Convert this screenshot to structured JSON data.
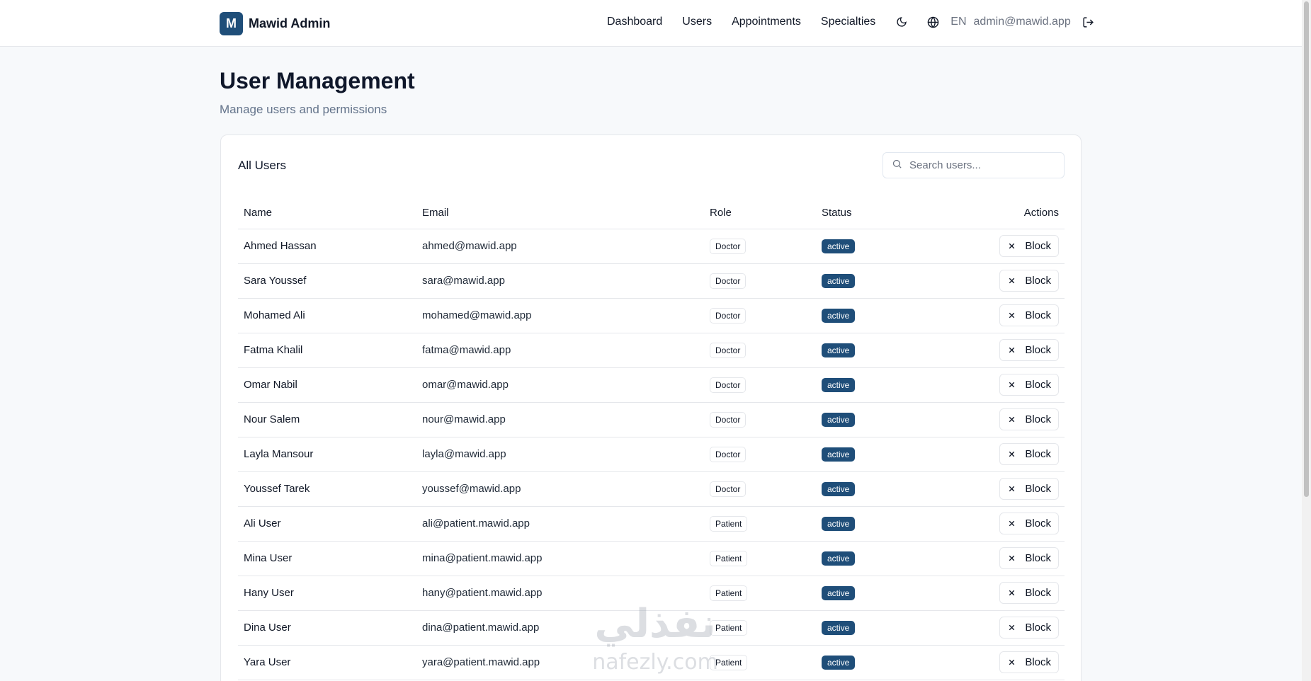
{
  "brand": {
    "logo_letter": "M",
    "name": "Mawid Admin"
  },
  "nav": {
    "links": [
      "Dashboard",
      "Users",
      "Appointments",
      "Specialties"
    ],
    "language": "EN",
    "user_email": "admin@mawid.app",
    "icons": [
      "moon-icon",
      "globe-icon",
      "logout-icon"
    ]
  },
  "page": {
    "title": "User Management",
    "subtitle": "Manage users and permissions"
  },
  "card": {
    "title": "All Users",
    "search_placeholder": "Search users...",
    "columns": [
      "Name",
      "Email",
      "Role",
      "Status",
      "Actions"
    ],
    "action_label": "Block",
    "rows": [
      {
        "name": "Ahmed Hassan",
        "email": "ahmed@mawid.app",
        "role": "Doctor",
        "status": "active"
      },
      {
        "name": "Sara Youssef",
        "email": "sara@mawid.app",
        "role": "Doctor",
        "status": "active"
      },
      {
        "name": "Mohamed Ali",
        "email": "mohamed@mawid.app",
        "role": "Doctor",
        "status": "active"
      },
      {
        "name": "Fatma Khalil",
        "email": "fatma@mawid.app",
        "role": "Doctor",
        "status": "active"
      },
      {
        "name": "Omar Nabil",
        "email": "omar@mawid.app",
        "role": "Doctor",
        "status": "active"
      },
      {
        "name": "Nour Salem",
        "email": "nour@mawid.app",
        "role": "Doctor",
        "status": "active"
      },
      {
        "name": "Layla Mansour",
        "email": "layla@mawid.app",
        "role": "Doctor",
        "status": "active"
      },
      {
        "name": "Youssef Tarek",
        "email": "youssef@mawid.app",
        "role": "Doctor",
        "status": "active"
      },
      {
        "name": "Ali User",
        "email": "ali@patient.mawid.app",
        "role": "Patient",
        "status": "active"
      },
      {
        "name": "Mina User",
        "email": "mina@patient.mawid.app",
        "role": "Patient",
        "status": "active"
      },
      {
        "name": "Hany User",
        "email": "hany@patient.mawid.app",
        "role": "Patient",
        "status": "active"
      },
      {
        "name": "Dina User",
        "email": "dina@patient.mawid.app",
        "role": "Patient",
        "status": "active"
      },
      {
        "name": "Yara User",
        "email": "yara@patient.mawid.app",
        "role": "Patient",
        "status": "active"
      }
    ]
  },
  "watermark": {
    "text_arabic": "نفذلي",
    "text_latin": "nafezly.com"
  },
  "colors": {
    "accent": "#1f4e79",
    "background": "#f7f9fb",
    "muted_text": "#64748b"
  }
}
